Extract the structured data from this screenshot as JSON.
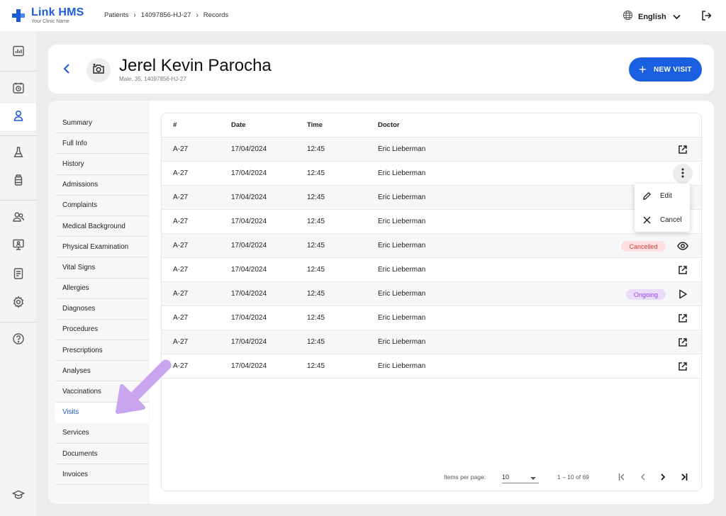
{
  "app": {
    "name": "Link HMS",
    "subtitle": "Your Clinic Name",
    "brand_color": "#1d5bd8",
    "accent_color": "#1a5fe0"
  },
  "breadcrumb": [
    "Patients",
    "14097856-HJ-27",
    "Records"
  ],
  "header_right": {
    "language": "English",
    "language_icon": "globe-icon",
    "logout_icon": "logout-icon"
  },
  "rail_icons": [
    "dashboard-icon",
    "calendar-clock-icon",
    "person-icon",
    "lab-flask-icon",
    "medicine-bottle-icon",
    "users-icon",
    "monitor-person-icon",
    "report-icon",
    "settings-gear-icon",
    "help-icon",
    "graduation-cap-icon"
  ],
  "patient": {
    "name": "Jerel Kevin Parocha",
    "details": "Male, 35, 14097856-HJ-27"
  },
  "actions": {
    "new_visit": "NEW VISIT"
  },
  "nav": {
    "items": [
      "Summary",
      "Full Info",
      "History",
      "Admissions",
      "Complaints",
      "Medical Background",
      "Physical Examination",
      "Vital Signs",
      "Allergies",
      "Diagnoses",
      "Procedures",
      "Prescriptions",
      "Analyses",
      "Vaccinations",
      "Visits",
      "Services",
      "Documents",
      "Invoices"
    ],
    "active": "Visits"
  },
  "table": {
    "columns": [
      "#",
      "Date",
      "Time",
      "Doctor"
    ],
    "rows": [
      {
        "num": "A-27",
        "date": "17/04/2024",
        "time": "12:45",
        "doctor": "Eric Lieberman",
        "status": "",
        "action": "open-external-icon"
      },
      {
        "num": "A-27",
        "date": "17/04/2024",
        "time": "12:45",
        "doctor": "Eric Lieberman",
        "status": "",
        "action": "more-vertical-icon"
      },
      {
        "num": "A-27",
        "date": "17/04/2024",
        "time": "12:45",
        "doctor": "Eric Lieberman",
        "status": "",
        "action": ""
      },
      {
        "num": "A-27",
        "date": "17/04/2024",
        "time": "12:45",
        "doctor": "Eric Lieberman",
        "status": "",
        "action": ""
      },
      {
        "num": "A-27",
        "date": "17/04/2024",
        "time": "12:45",
        "doctor": "Eric Lieberman",
        "status": "Cancelled",
        "action": "eye-icon"
      },
      {
        "num": "A-27",
        "date": "17/04/2024",
        "time": "12:45",
        "doctor": "Eric Lieberman",
        "status": "",
        "action": "open-external-icon"
      },
      {
        "num": "A-27",
        "date": "17/04/2024",
        "time": "12:45",
        "doctor": "Eric Lieberman",
        "status": "Ongoing",
        "action": "play-icon"
      },
      {
        "num": "A-27",
        "date": "17/04/2024",
        "time": "12:45",
        "doctor": "Eric Lieberman",
        "status": "",
        "action": "open-external-icon"
      },
      {
        "num": "A-27",
        "date": "17/04/2024",
        "time": "12:45",
        "doctor": "Eric Lieberman",
        "status": "",
        "action": "open-external-icon"
      },
      {
        "num": "A-27",
        "date": "17/04/2024",
        "time": "12:45",
        "doctor": "Eric Lieberman",
        "status": "",
        "action": "open-external-icon"
      }
    ]
  },
  "context_menu": {
    "items": [
      {
        "label": "Edit",
        "icon": "pencil-icon"
      },
      {
        "label": "Cancel",
        "icon": "close-icon"
      }
    ]
  },
  "status_colors": {
    "cancelled_bg": "#fde1e1",
    "cancelled_text": "#d43a3a",
    "ongoing_bg": "#ecdcfb",
    "ongoing_text": "#9b46e0"
  },
  "pagination": {
    "items_per_page_label": "Items per page:",
    "items_per_page": "10",
    "range": "1 – 10 of 69"
  },
  "annotation": {
    "arrow_color": "#c9a6ef",
    "arrow_icon": "pointer-arrow-icon"
  }
}
